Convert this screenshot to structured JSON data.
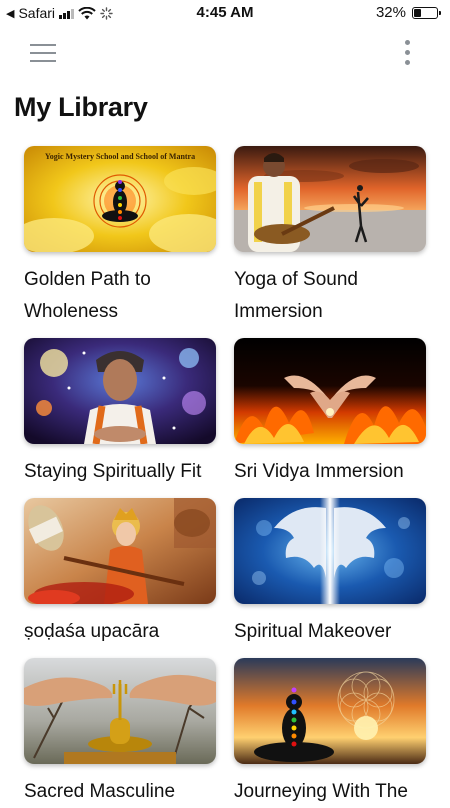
{
  "status_bar": {
    "back_app": "Safari",
    "time": "4:45 AM",
    "battery_percent": "32%",
    "battery_level": 0.32
  },
  "header": {
    "menu_icon": "hamburger-menu-icon",
    "more_icon": "vertical-dots-icon",
    "title": "My Library"
  },
  "library": {
    "items": [
      {
        "title": "Golden Path to Wholeness",
        "image": "meditation-golden-clouds",
        "banner": "Yogic Mystery School and School of Mantra"
      },
      {
        "title": "Yoga of Sound Immersion",
        "image": "sitar-player-beach-sunset"
      },
      {
        "title": "Staying Spiritually Fit",
        "image": "teacher-cosmic-background"
      },
      {
        "title": "Sri Vidya Immersion",
        "image": "hands-mudra-fire"
      },
      {
        "title": "ṣoḍaśa upacāra",
        "image": "goddess-offerings"
      },
      {
        "title": "Spiritual Makeover",
        "image": "angel-wings-blue-bokeh"
      },
      {
        "title": "Sacred Masculine",
        "image": "hands-shiva-lingam"
      },
      {
        "title": "Journeying With The",
        "image": "chakra-meditation-sunset"
      }
    ]
  }
}
